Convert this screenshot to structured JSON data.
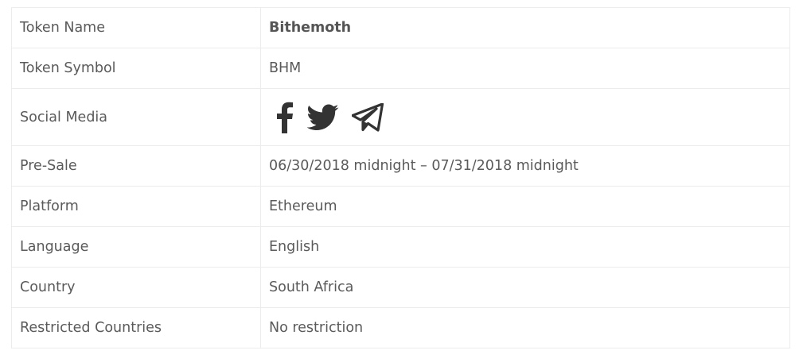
{
  "table": {
    "rows": [
      {
        "label": "Token Name",
        "value": "Bithemoth"
      },
      {
        "label": "Token Symbol",
        "value": "BHM"
      },
      {
        "label": "Social Media",
        "icons": [
          "facebook-icon",
          "twitter-icon",
          "telegram-icon"
        ]
      },
      {
        "label": "Pre-Sale",
        "value": "06/30/2018 midnight – 07/31/2018 midnight"
      },
      {
        "label": "Platform",
        "value": "Ethereum"
      },
      {
        "label": "Language",
        "value": "English"
      },
      {
        "label": "Country",
        "value": "South Africa"
      },
      {
        "label": "Restricted Countries",
        "value": "No restriction"
      }
    ]
  },
  "colors": {
    "text": "#5a5a5a",
    "border": "#ececec",
    "icon": "#333333"
  }
}
